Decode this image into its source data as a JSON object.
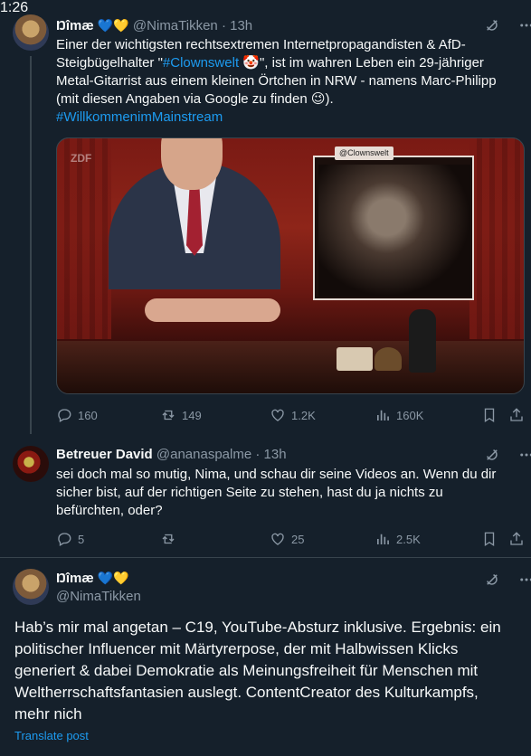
{
  "tweet1": {
    "name": "Ŋîmæ",
    "hearts": "💙💛",
    "handle": "@NimaTikken",
    "time": "13h",
    "text_lines": [
      [
        "Einer der wichtigsten rechtsextremen Internetpropagandisten & AfD-"
      ],
      [
        "Steigbügelhalter \"",
        {
          "link": "#Clownswelt"
        },
        " 🤡",
        "\", ist im wahren Leben ein 29-jähriger"
      ],
      [
        "Metal-Gitarrist aus einem kleinen Örtchen in NRW - namens Marc-Philipp"
      ],
      [
        "(mit diesen Angaben via Google zu finden ",
        "😉",
        ")."
      ],
      [
        {
          "link": "#WillkommenimMainstream"
        }
      ]
    ],
    "video": {
      "duration": "1:26",
      "overlay_tag": "@Clownswelt",
      "logo": "ZDF"
    },
    "stats": {
      "replies": "160",
      "reposts": "149",
      "likes": "1.2K",
      "views": "160K"
    }
  },
  "tweet2": {
    "name": "Betreuer David",
    "handle": "@ananaspalme",
    "time": "13h",
    "text_lines": [
      "sei doch mal so mutig, Nima, und schau dir seine Videos an. Wenn du dir",
      "sicher bist, auf der richtigen Seite zu stehen, hast du ja nichts zu",
      "befürchten, oder?"
    ],
    "stats": {
      "replies": "5",
      "reposts": "",
      "likes": "25",
      "views": "2.5K"
    }
  },
  "tweet3": {
    "name": "Ŋîmæ",
    "hearts": "💙💛",
    "handle": "@NimaTikken",
    "text": "Hab’s mir mal angetan – C19, YouTube-Absturz inklusive. Ergebnis: ein politischer Influencer mit Märtyrerpose, der mit Halbwissen Klicks generiert & dabei Demokratie als Meinungsfreiheit für Menschen mit Weltherrschaftsfantasien auslegt. ContentCreator des Kulturkampfs, mehr nich",
    "translate": "Translate post"
  },
  "colors": {
    "background": "#15202b",
    "text": "#f7f9f9",
    "muted": "#8b98a5",
    "accent": "#1d9bf0",
    "border": "#38444d"
  },
  "icons": [
    "grok-icon",
    "more-icon",
    "reply-icon",
    "repost-icon",
    "like-icon",
    "views-icon",
    "bookmark-icon",
    "share-icon"
  ]
}
